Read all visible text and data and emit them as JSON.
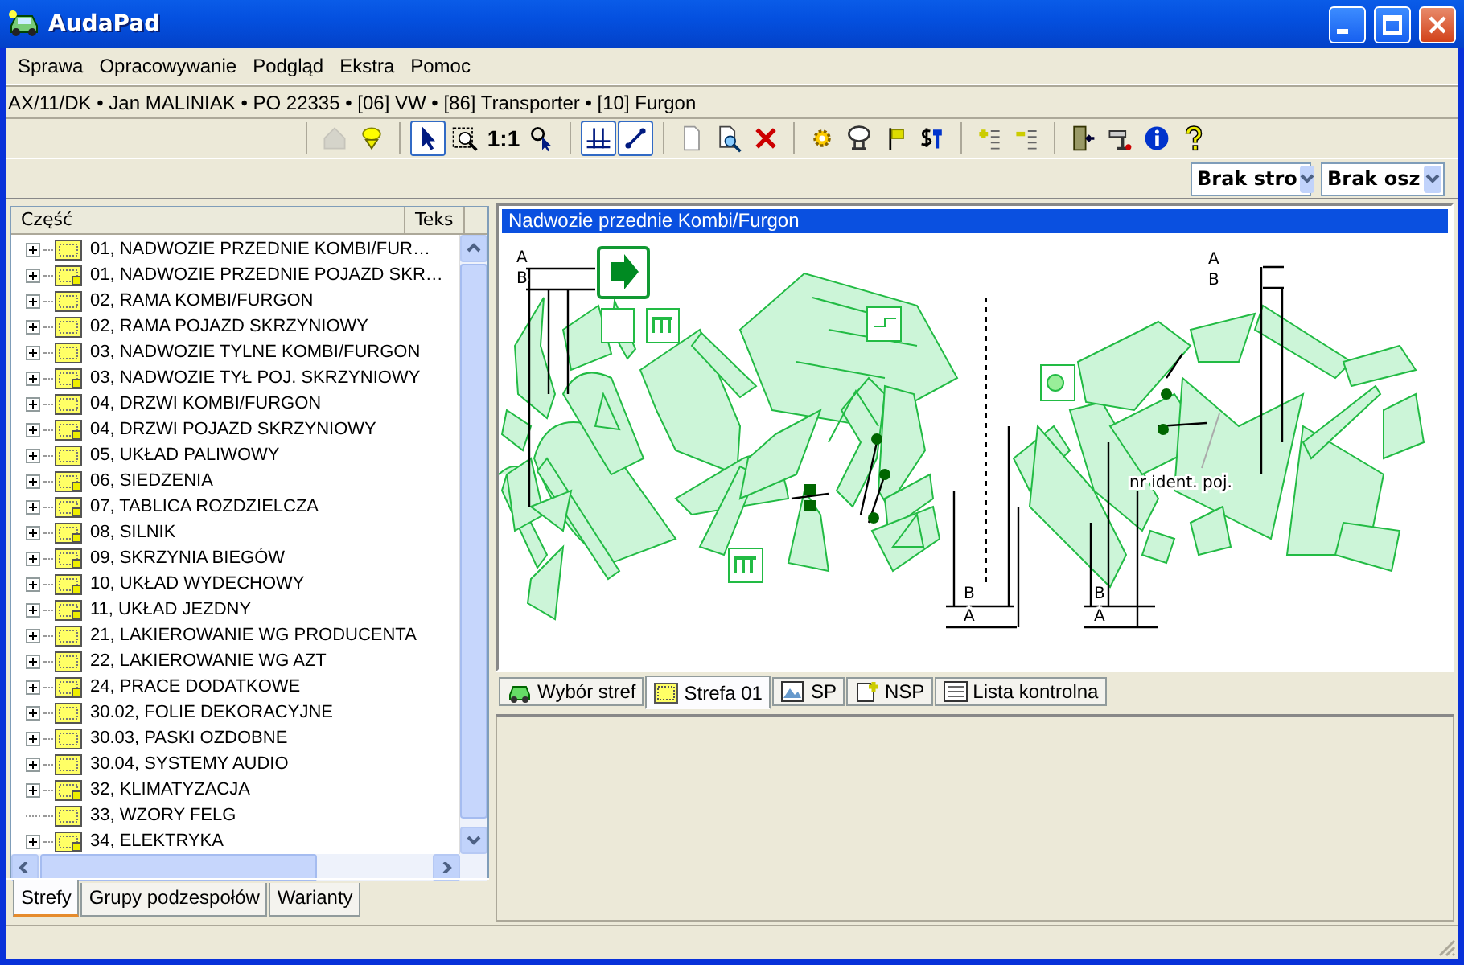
{
  "window": {
    "title": "AudaPad"
  },
  "menu": [
    {
      "label": "Sprawa"
    },
    {
      "label": "Opracowywanie"
    },
    {
      "label": "Podgląd"
    },
    {
      "label": "Ekstra"
    },
    {
      "label": "Pomoc"
    }
  ],
  "case_info": "AX/11/DK • Jan MALINIAK • PO 22335 •  [06] VW • [86] Transporter • [10] Furgon",
  "toolbar": {
    "groups": [
      [
        {
          "disabled": true,
          "pressed": false
        },
        {
          "disabled": false,
          "pressed": false
        }
      ],
      [
        {
          "disabled": false,
          "pressed": true
        },
        {
          "disabled": false,
          "pressed": false
        },
        {
          "disabled": false,
          "pressed": false,
          "label": "1:1"
        },
        {
          "disabled": false,
          "pressed": false
        }
      ],
      [
        {
          "disabled": false,
          "pressed": true
        },
        {
          "disabled": false,
          "pressed": true
        }
      ],
      [
        {
          "disabled": false,
          "pressed": false
        },
        {
          "disabled": false,
          "pressed": false
        },
        {
          "disabled": false,
          "pressed": false
        }
      ],
      [
        {
          "disabled": false,
          "pressed": false
        },
        {
          "disabled": false,
          "pressed": false
        },
        {
          "disabled": false,
          "pressed": false
        },
        {
          "disabled": false,
          "pressed": false
        }
      ],
      [
        {
          "disabled": false,
          "pressed": false
        },
        {
          "disabled": false,
          "pressed": false
        }
      ],
      [
        {
          "disabled": false,
          "pressed": false
        },
        {
          "disabled": false,
          "pressed": false
        },
        {
          "disabled": false,
          "pressed": false
        },
        {
          "disabled": false,
          "pressed": false
        }
      ]
    ]
  },
  "dropdowns": [
    {
      "value": "Brak stro"
    },
    {
      "value": "Brak osz"
    }
  ],
  "tree": {
    "columns": [
      "Część",
      "Teks"
    ],
    "items": [
      {
        "label": "01, NADWOZIE PRZEDNIE KOMBI/FUR…",
        "expandable": true,
        "kind": "plain"
      },
      {
        "label": "01, NADWOZIE PRZEDNIE POJAZD SKR…",
        "expandable": true,
        "kind": "marked"
      },
      {
        "label": "02, RAMA KOMBI/FURGON",
        "expandable": true,
        "kind": "plain"
      },
      {
        "label": "02, RAMA POJAZD SKRZYNIOWY",
        "expandable": true,
        "kind": "plain"
      },
      {
        "label": "03, NADWOZIE TYLNE KOMBI/FURGON",
        "expandable": true,
        "kind": "plain"
      },
      {
        "label": "03, NADWOZIE TYŁ POJ. SKRZYNIOWY",
        "expandable": true,
        "kind": "marked"
      },
      {
        "label": "04, DRZWI KOMBI/FURGON",
        "expandable": true,
        "kind": "plain"
      },
      {
        "label": "04, DRZWI POJAZD SKRZYNIOWY",
        "expandable": true,
        "kind": "marked"
      },
      {
        "label": "05, UKŁAD PALIWOWY",
        "expandable": true,
        "kind": "plain"
      },
      {
        "label": "06, SIEDZENIA",
        "expandable": true,
        "kind": "marked"
      },
      {
        "label": "07, TABLICA ROZDZIELCZA",
        "expandable": true,
        "kind": "marked"
      },
      {
        "label": "08, SILNIK",
        "expandable": true,
        "kind": "marked"
      },
      {
        "label": "09, SKRZYNIA BIEGÓW",
        "expandable": true,
        "kind": "marked"
      },
      {
        "label": "10, UKŁAD WYDECHOWY",
        "expandable": true,
        "kind": "marked"
      },
      {
        "label": "11, UKŁAD JEZDNY",
        "expandable": true,
        "kind": "marked"
      },
      {
        "label": "21, LAKIEROWANIE WG PRODUCENTA",
        "expandable": true,
        "kind": "plain"
      },
      {
        "label": "22, LAKIEROWANIE WG AZT",
        "expandable": true,
        "kind": "plain"
      },
      {
        "label": "24, PRACE DODATKOWE",
        "expandable": true,
        "kind": "marked"
      },
      {
        "label": "30.02, FOLIE DEKORACYJNE",
        "expandable": true,
        "kind": "plain"
      },
      {
        "label": "30.03, PASKI OZDOBNE",
        "expandable": true,
        "kind": "plain"
      },
      {
        "label": "30.04, SYSTEMY AUDIO",
        "expandable": true,
        "kind": "plain"
      },
      {
        "label": "32, KLIMATYZACJA",
        "expandable": true,
        "kind": "marked"
      },
      {
        "label": "33, WZORY FELG",
        "expandable": false,
        "kind": "plain"
      },
      {
        "label": "34, ELEKTRYKA",
        "expandable": true,
        "kind": "marked"
      }
    ]
  },
  "left_tabs": [
    {
      "label": "Strefy",
      "selected": true
    },
    {
      "label": "Grupy podzespołów",
      "selected": false
    },
    {
      "label": "Warianty",
      "selected": false
    }
  ],
  "diagram": {
    "title": "Nadwozie przednie Kombi/Furgon",
    "labels": [
      "A",
      "B",
      "A",
      "B",
      "B",
      "A",
      "B",
      "A",
      "nr ident. poj."
    ]
  },
  "view_tabs": [
    {
      "label": "Wybór stref",
      "selected": false
    },
    {
      "label": "Strefa 01",
      "selected": true
    },
    {
      "label": "SP",
      "selected": false
    },
    {
      "label": "NSP",
      "selected": false
    },
    {
      "label": "Lista kontrolna",
      "selected": false
    }
  ]
}
